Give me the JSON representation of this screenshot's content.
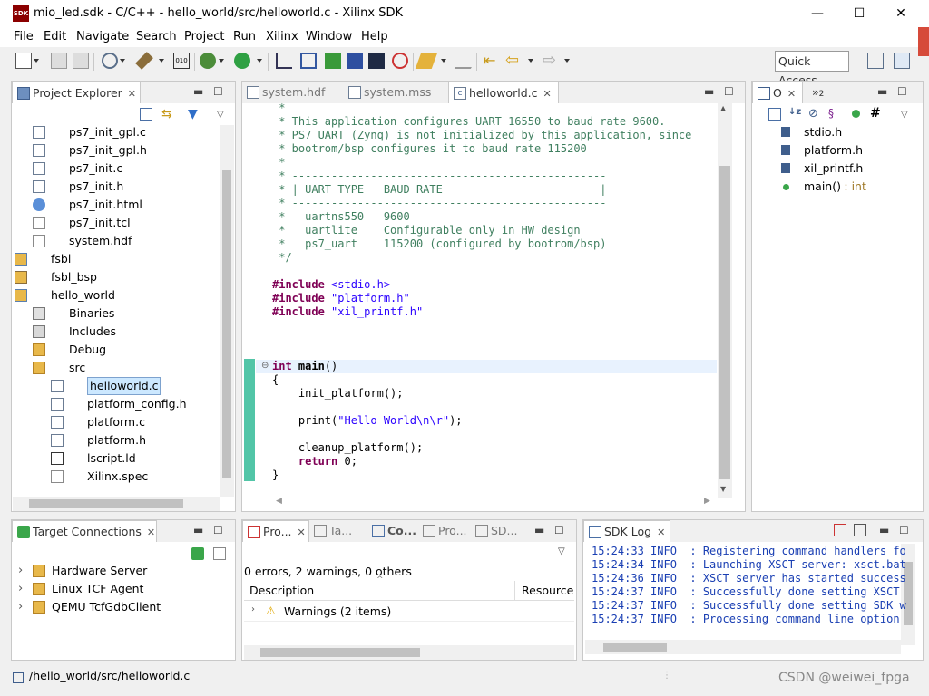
{
  "window": {
    "title": "mio_led.sdk - C/C++ - hello_world/src/helloworld.c - Xilinx SDK",
    "app_icon_text": "SDK",
    "minimize": "—",
    "maximize": "☐",
    "close": "✕"
  },
  "menu": [
    "File",
    "Edit",
    "Navigate",
    "Search",
    "Project",
    "Run",
    "Xilinx",
    "Window",
    "Help"
  ],
  "toolbar": {
    "quick_access": "Quick Access"
  },
  "project_explorer": {
    "title": "Project Explorer",
    "items": [
      {
        "label": "ps7_init_gpl.c",
        "icon": "c-file-icon"
      },
      {
        "label": "ps7_init_gpl.h",
        "icon": "h-file-icon"
      },
      {
        "label": "ps7_init.c",
        "icon": "c-file-icon"
      },
      {
        "label": "ps7_init.h",
        "icon": "h-file-icon"
      },
      {
        "label": "ps7_init.html",
        "icon": "html-file-icon"
      },
      {
        "label": "ps7_init.tcl",
        "icon": "file-icon"
      },
      {
        "label": "system.hdf",
        "icon": "file-icon"
      },
      {
        "label": "fsbl",
        "icon": "project-icon"
      },
      {
        "label": "fsbl_bsp",
        "icon": "bsp-icon"
      },
      {
        "label": "hello_world",
        "icon": "project-icon"
      },
      {
        "label": "Binaries",
        "icon": "binaries-icon"
      },
      {
        "label": "Includes",
        "icon": "includes-icon"
      },
      {
        "label": "Debug",
        "icon": "folder-icon"
      },
      {
        "label": "src",
        "icon": "folder-icon"
      },
      {
        "label": "helloworld.c",
        "icon": "c-file-icon"
      },
      {
        "label": "platform_config.h",
        "icon": "h-file-icon"
      },
      {
        "label": "platform.c",
        "icon": "c-file-icon"
      },
      {
        "label": "platform.h",
        "icon": "h-file-icon"
      },
      {
        "label": "lscript.ld",
        "icon": "ld-file-icon"
      },
      {
        "label": "Xilinx.spec",
        "icon": "spec-file-icon"
      }
    ]
  },
  "editor": {
    "tabs": [
      "system.hdf",
      "system.mss",
      "helloworld.c"
    ],
    "active_tab": "helloworld.c",
    "code_lines": [
      " *",
      " * This application configures UART 16550 to baud rate 9600.",
      " * PS7 UART (Zynq) is not initialized by this application, since",
      " * bootrom/bsp configures it to baud rate 115200",
      " *",
      " * ------------------------------------------------",
      " * | UART TYPE   BAUD RATE                        |",
      " * ------------------------------------------------",
      " *   uartns550   9600",
      " *   uartlite    Configurable only in HW design",
      " *   ps7_uart    115200 (configured by bootrom/bsp)",
      " */",
      "",
      "#include <stdio.h>",
      "#include \"platform.h\"",
      "#include \"xil_printf.h\"",
      "",
      "",
      "",
      "int main()",
      "{",
      "    init_platform();",
      "",
      "    print(\"Hello World\\n\\r\");",
      "",
      "    cleanup_platform();",
      "    return 0;",
      "}"
    ]
  },
  "outline": {
    "tab1": "O",
    "tab2": "»",
    "tab2_count": "2",
    "items": [
      {
        "label": "stdio.h",
        "suffix": ""
      },
      {
        "label": "platform.h",
        "suffix": ""
      },
      {
        "label": "xil_printf.h",
        "suffix": ""
      },
      {
        "label": "main()",
        "suffix": " : int"
      }
    ]
  },
  "target_connections": {
    "title": "Target Connections",
    "items": [
      "Hardware Server",
      "Linux TCF Agent",
      "QEMU TcfGdbClient"
    ]
  },
  "problems": {
    "tabs": [
      "Pro...",
      "Ta...",
      "Co...",
      "Pro...",
      "SD..."
    ],
    "summary": "0 errors, 2 warnings, 0 others",
    "col_description": "Description",
    "col_resource": "Resource",
    "warnings_row": "Warnings (2 items)"
  },
  "sdk_log": {
    "title": "SDK Log",
    "lines": [
      "15:24:33 INFO  : Registering command handlers fo",
      "15:24:34 INFO  : Launching XSCT server: xsct.bat",
      "15:24:36 INFO  : XSCT server has started success",
      "15:24:37 INFO  : Successfully done setting XSCT",
      "15:24:37 INFO  : Successfully done setting SDK w",
      "15:24:37 INFO  : Processing command line option"
    ]
  },
  "status": {
    "path": "/hello_world/src/helloworld.c",
    "watermark": "CSDN @weiwei_fpga"
  },
  "colors": {
    "comment": "#3f7f5f",
    "keyword": "#7f0055",
    "string": "#2a00ff",
    "log": "#1a3fb3",
    "selection": "#cce8ff"
  }
}
